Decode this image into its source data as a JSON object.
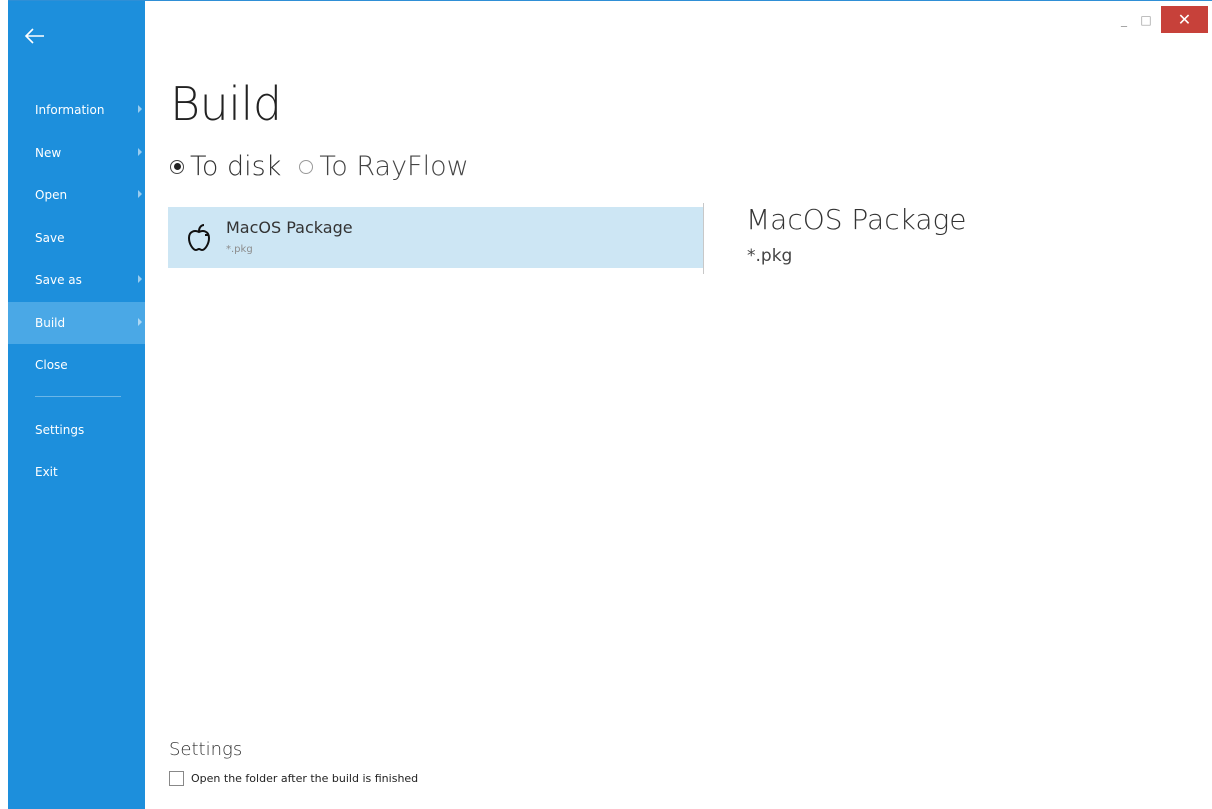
{
  "sidebar": {
    "back_icon": "back-arrow-icon",
    "items": [
      {
        "label": "Information",
        "has_arrow": true
      },
      {
        "label": "New",
        "has_arrow": true
      },
      {
        "label": "Open",
        "has_arrow": true
      },
      {
        "label": "Save",
        "has_arrow": false
      },
      {
        "label": "Save as",
        "has_arrow": true
      },
      {
        "label": "Build",
        "has_arrow": true,
        "active": true
      },
      {
        "label": "Close",
        "has_arrow": false
      }
    ],
    "bottom_items": [
      {
        "label": "Settings"
      },
      {
        "label": "Exit"
      }
    ],
    "color": "#1d8fdc",
    "active_color": "#4aa8e6"
  },
  "window_controls": {
    "minimize": "_",
    "maximize": "□",
    "close": "✕",
    "close_color": "#c7413a"
  },
  "main": {
    "title": "Build",
    "targets": [
      {
        "label": "To disk",
        "selected": true
      },
      {
        "label": "To RayFlow",
        "selected": false
      }
    ],
    "packages": [
      {
        "name": "MacOS Package",
        "ext": "*.pkg",
        "icon": "apple-icon",
        "selected": true
      }
    ],
    "detail": {
      "title": "MacOS Package",
      "ext": "*.pkg"
    },
    "settings": {
      "title": "Settings",
      "open_folder_label": "Open the folder after the build is finished",
      "open_folder_checked": false
    }
  }
}
